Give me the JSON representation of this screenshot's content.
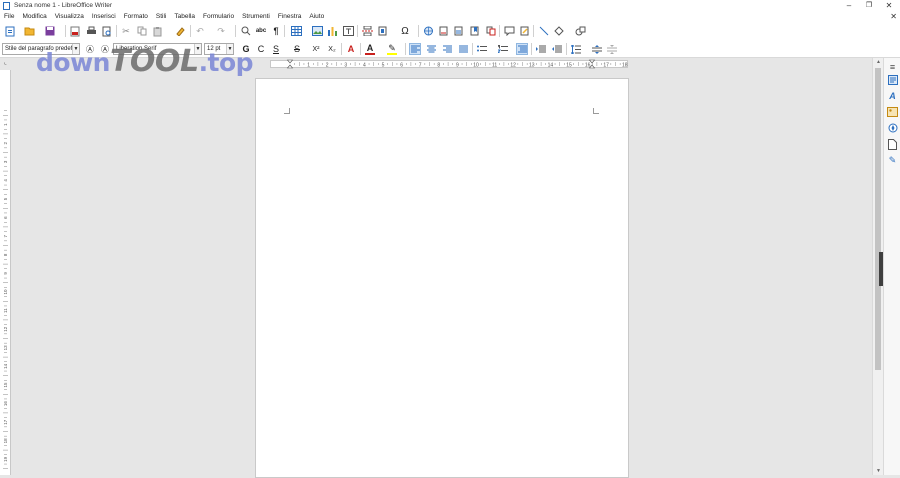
{
  "titlebar": {
    "title": "Senza nome 1 - LibreOffice Writer",
    "minimize": "–",
    "restore": "❐",
    "close": "✕"
  },
  "menu": {
    "items": [
      "File",
      "Modifica",
      "Visualizza",
      "Inserisci",
      "Formato",
      "Stili",
      "Tabella",
      "Formulario",
      "Strumenti",
      "Finestra",
      "Aiuto"
    ],
    "close_doc": "✕"
  },
  "formatting": {
    "paragraph_style": "Stile del paragrafo predefinito",
    "font_name": "Liberation Serif",
    "font_size": "12 pt",
    "bold": "G",
    "italic": "C",
    "underline": "S",
    "strike": "S",
    "superscript": "X²",
    "subscript": "X₂"
  },
  "ruler": {
    "h_numbers": [
      "1",
      "2",
      "3",
      "4",
      "5",
      "6",
      "7",
      "8",
      "9",
      "10",
      "11",
      "12",
      "13",
      "14",
      "15",
      "16",
      "17",
      "18"
    ],
    "v_numbers": [
      "1",
      "2",
      "3",
      "4",
      "5",
      "6",
      "7",
      "8",
      "9",
      "10",
      "11",
      "12",
      "13",
      "14",
      "15",
      "16",
      "17",
      "18",
      "19",
      "20",
      "21"
    ]
  },
  "watermark": {
    "part1": "down",
    "part2": "TOOL",
    "part3": ".top"
  },
  "colors": {
    "accent": "#2c6fbf",
    "font_color_bar": "#c9211e",
    "highlight_bar": "#ffff00",
    "watermark_blue": "#7a86d6"
  },
  "icons": {
    "new": "new-document-icon",
    "open": "open-icon",
    "save": "save-icon",
    "export_pdf": "export-pdf-icon",
    "print": "print-icon",
    "print_preview": "print-preview-icon",
    "cut": "cut-icon",
    "copy": "copy-icon",
    "paste": "paste-icon",
    "clone": "clone-formatting-icon",
    "undo": "undo-icon",
    "redo": "redo-icon",
    "find": "find-replace-icon",
    "spell": "spelling-icon",
    "pilcrow": "formatting-marks-icon",
    "table": "insert-table-icon",
    "image": "insert-image-icon",
    "chart": "insert-chart-icon",
    "textbox": "insert-textbox-icon",
    "pagebreak": "page-break-icon",
    "field": "insert-field-icon",
    "special": "special-character-icon",
    "hyperlink": "hyperlink-icon",
    "footnote": "footnote-icon",
    "endnote": "endnote-icon",
    "bookmark": "bookmark-icon",
    "crossref": "cross-reference-icon",
    "comment": "comment-icon",
    "trackchanges": "track-changes-icon",
    "line": "line-icon",
    "shapes": "basic-shapes-icon",
    "draw": "draw-functions-icon"
  }
}
